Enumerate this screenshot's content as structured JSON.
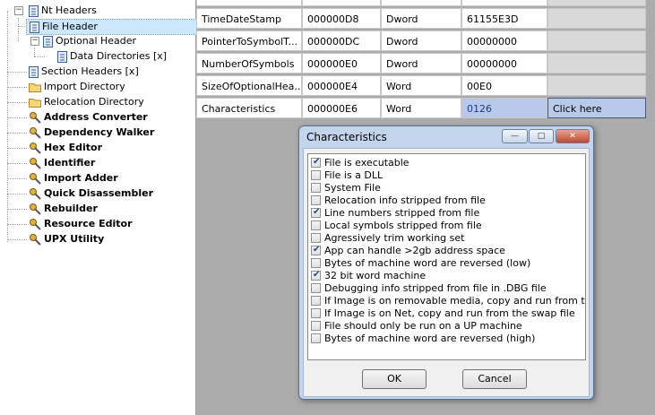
{
  "tree": {
    "items": [
      {
        "label": "Nt Headers",
        "bold": false,
        "icon": "page-icon"
      },
      {
        "label": "File Header",
        "bold": false,
        "icon": "page-icon",
        "selected": true
      },
      {
        "label": "Optional Header",
        "bold": false,
        "icon": "page-icon"
      },
      {
        "label": "Data Directories [x]",
        "bold": false,
        "icon": "page-icon"
      },
      {
        "label": "Section Headers [x]",
        "bold": false,
        "icon": "page-icon"
      },
      {
        "label": "Import Directory",
        "bold": false,
        "icon": "folder-icon"
      },
      {
        "label": "Relocation Directory",
        "bold": false,
        "icon": "folder-icon"
      },
      {
        "label": "Address Converter",
        "bold": true,
        "icon": "tool-icon"
      },
      {
        "label": "Dependency Walker",
        "bold": true,
        "icon": "tool-icon"
      },
      {
        "label": "Hex Editor",
        "bold": true,
        "icon": "tool-icon"
      },
      {
        "label": "Identifier",
        "bold": true,
        "icon": "tool-icon"
      },
      {
        "label": "Import Adder",
        "bold": true,
        "icon": "tool-icon"
      },
      {
        "label": "Quick Disassembler",
        "bold": true,
        "icon": "tool-icon"
      },
      {
        "label": "Rebuilder",
        "bold": true,
        "icon": "tool-icon"
      },
      {
        "label": "Resource Editor",
        "bold": true,
        "icon": "tool-icon"
      },
      {
        "label": "UPX Utility",
        "bold": true,
        "icon": "tool-icon"
      }
    ]
  },
  "table": {
    "rows": [
      {
        "member": "TimeDateStamp",
        "offset": "000000D8",
        "size": "Dword",
        "value": "61155E3D"
      },
      {
        "member": "PointerToSymbolT...",
        "offset": "000000DC",
        "size": "Dword",
        "value": "00000000"
      },
      {
        "member": "NumberOfSymbols",
        "offset": "000000E0",
        "size": "Dword",
        "value": "00000000"
      },
      {
        "member": "SizeOfOptionalHea...",
        "offset": "000000E4",
        "size": "Word",
        "value": "00E0"
      },
      {
        "member": "Characteristics",
        "offset": "000000E6",
        "size": "Word",
        "value": "0126",
        "action": "Click here"
      }
    ]
  },
  "dialog": {
    "title": "Characteristics",
    "minimize_glyph": "—",
    "maximize_glyph": "□",
    "close_glyph": "✕",
    "options": [
      {
        "label": "File is executable",
        "checked": true
      },
      {
        "label": "File is a DLL",
        "checked": false
      },
      {
        "label": "System File",
        "checked": false
      },
      {
        "label": "Relocation info stripped from file",
        "checked": false
      },
      {
        "label": "Line numbers stripped from file",
        "checked": true
      },
      {
        "label": "Local symbols stripped from file",
        "checked": false
      },
      {
        "label": "Agressively trim working set",
        "checked": false
      },
      {
        "label": "App can handle >2gb address space",
        "checked": true
      },
      {
        "label": "Bytes of machine word are reversed (low)",
        "checked": false
      },
      {
        "label": "32 bit word machine",
        "checked": true
      },
      {
        "label": "Debugging info stripped from file in .DBG file",
        "checked": false
      },
      {
        "label": "If Image is on removable media, copy and run from the swap file",
        "checked": false
      },
      {
        "label": "If Image is on Net, copy and run from the swap file",
        "checked": false
      },
      {
        "label": "File should only be run on a UP machine",
        "checked": false
      },
      {
        "label": "Bytes of machine word are reversed (high)",
        "checked": false
      }
    ],
    "ok_label": "OK",
    "cancel_label": "Cancel"
  },
  "colors": {
    "selected_row": "#cce8ff",
    "panel_background": "#ababab",
    "highlight_cell": "#b9c9ea",
    "dialog_frame": "#c3d5ec"
  }
}
